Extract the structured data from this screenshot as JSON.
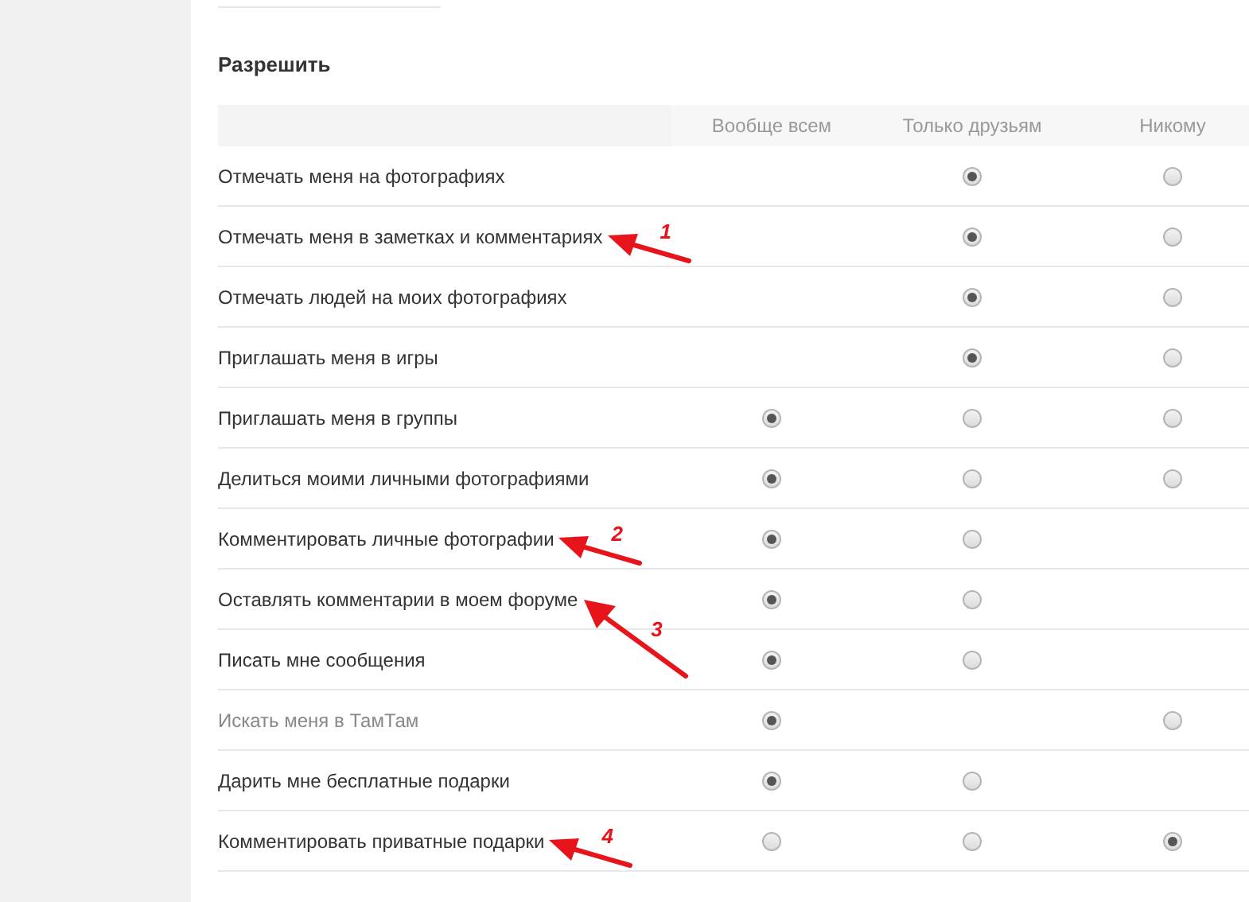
{
  "section": {
    "title": "Разрешить"
  },
  "columns": [
    "Вообще всем",
    "Только друзьям",
    "Никому"
  ],
  "rows": [
    {
      "label": "Отмечать меня на фотографиях",
      "disabled": false,
      "options": [
        {
          "kind": "none"
        },
        {
          "kind": "radio",
          "selected": true
        },
        {
          "kind": "radio",
          "selected": false
        }
      ]
    },
    {
      "label": "Отмечать меня в заметках и комментариях",
      "disabled": false,
      "callout": {
        "number": "1",
        "kind": "shallow"
      },
      "options": [
        {
          "kind": "none"
        },
        {
          "kind": "radio",
          "selected": true
        },
        {
          "kind": "radio",
          "selected": false
        }
      ]
    },
    {
      "label": "Отмечать людей на моих фотографиях",
      "disabled": false,
      "options": [
        {
          "kind": "none"
        },
        {
          "kind": "radio",
          "selected": true
        },
        {
          "kind": "radio",
          "selected": false
        }
      ]
    },
    {
      "label": "Приглашать меня в игры",
      "disabled": false,
      "options": [
        {
          "kind": "none"
        },
        {
          "kind": "radio",
          "selected": true
        },
        {
          "kind": "radio",
          "selected": false
        }
      ]
    },
    {
      "label": "Приглашать меня в группы",
      "disabled": false,
      "options": [
        {
          "kind": "radio",
          "selected": true
        },
        {
          "kind": "radio",
          "selected": false
        },
        {
          "kind": "radio",
          "selected": false
        }
      ]
    },
    {
      "label": "Делиться моими личными фотографиями",
      "disabled": false,
      "options": [
        {
          "kind": "radio",
          "selected": true
        },
        {
          "kind": "radio",
          "selected": false
        },
        {
          "kind": "radio",
          "selected": false
        }
      ]
    },
    {
      "label": "Комментировать личные фотографии",
      "disabled": false,
      "callout": {
        "number": "2",
        "kind": "shallow"
      },
      "options": [
        {
          "kind": "radio",
          "selected": true
        },
        {
          "kind": "radio",
          "selected": false
        },
        {
          "kind": "none"
        }
      ]
    },
    {
      "label": "Оставлять комментарии в моем форуме",
      "disabled": false,
      "callout": {
        "number": "3",
        "kind": "steep"
      },
      "options": [
        {
          "kind": "radio",
          "selected": true
        },
        {
          "kind": "radio",
          "selected": false
        },
        {
          "kind": "none"
        }
      ]
    },
    {
      "label": "Писать мне сообщения",
      "disabled": false,
      "options": [
        {
          "kind": "radio",
          "selected": true
        },
        {
          "kind": "radio",
          "selected": false
        },
        {
          "kind": "none"
        }
      ]
    },
    {
      "label": "Искать меня в ТамТам",
      "disabled": true,
      "options": [
        {
          "kind": "radio",
          "selected": true
        },
        {
          "kind": "none"
        },
        {
          "kind": "radio",
          "selected": false
        }
      ]
    },
    {
      "label": "Дарить мне бесплатные подарки",
      "disabled": false,
      "options": [
        {
          "kind": "radio",
          "selected": true
        },
        {
          "kind": "radio",
          "selected": false
        },
        {
          "kind": "none"
        }
      ]
    },
    {
      "label": "Комментировать приватные подарки",
      "disabled": false,
      "callout": {
        "number": "4",
        "kind": "shallow"
      },
      "options": [
        {
          "kind": "radio",
          "selected": false
        },
        {
          "kind": "radio",
          "selected": false
        },
        {
          "kind": "radio",
          "selected": true
        }
      ]
    }
  ]
}
